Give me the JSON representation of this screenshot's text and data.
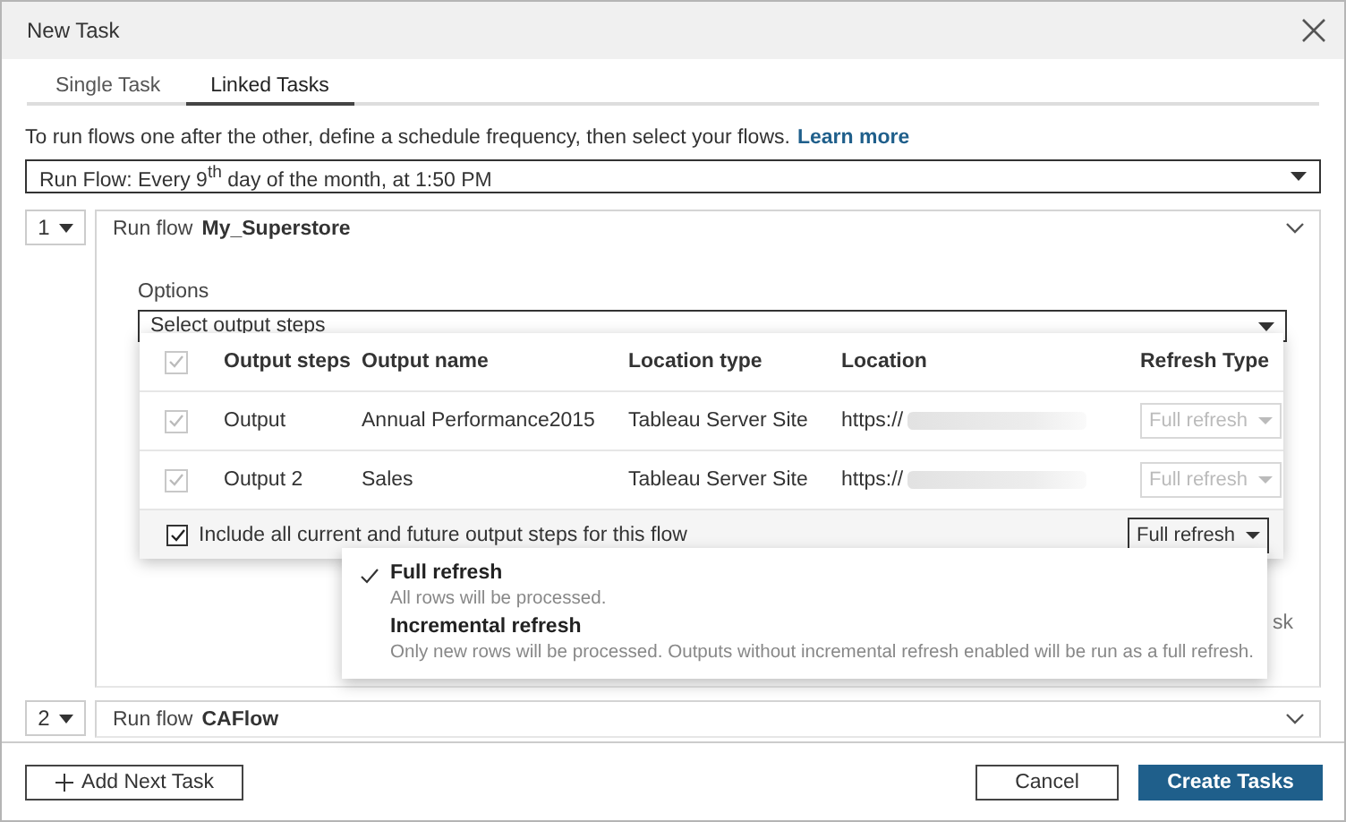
{
  "window": {
    "title": "New Task"
  },
  "tabs": [
    {
      "label": "Single Task",
      "selected": false
    },
    {
      "label": "Linked Tasks",
      "selected": true
    }
  ],
  "intro": {
    "text": "To run flows one after the other, define a schedule frequency, then select your flows.",
    "link": "Learn more"
  },
  "schedule": {
    "value": "Run Flow: Every 9$^{th}$ day of the month, at 1:50 PM"
  },
  "tasks": [
    {
      "number": "1",
      "prefix": "Run flow",
      "flow": "My_Superstore",
      "options": {
        "label": "Options",
        "select": "Select output steps",
        "header_checked": true,
        "header_disabled": true,
        "columns": [
          "Output steps",
          "Output name",
          "Location type",
          "Location",
          "Refresh Type"
        ],
        "rows": [
          {
            "step": "Output",
            "name": "Annual Performance2015",
            "location_type": "Tableau Server Site",
            "location": "https://",
            "refresh": "Full refresh",
            "checked": true,
            "disabled": true
          },
          {
            "step": "Output 2",
            "name": "Sales",
            "location_type": "Tableau Server Site",
            "location": "https://",
            "refresh": "Full refresh",
            "checked": true,
            "disabled": true
          }
        ],
        "include": {
          "label": "Include all current and future output steps for this flow",
          "checked": true,
          "refresh": "Full refresh"
        },
        "refresh_menu": [
          {
            "title": "Full refresh",
            "description": "All rows will be processed.",
            "selected": true
          },
          {
            "title": "Incremental refresh",
            "description": "Only new rows will be processed. Outputs without incremental refresh enabled will be run as a full refresh.",
            "selected": false
          }
        ],
        "partial_text": "sk"
      }
    },
    {
      "number": "2",
      "prefix": "Run flow",
      "flow": "CAFlow"
    }
  ],
  "footer": {
    "add": "Add Next Task",
    "cancel": "Cancel",
    "create": "Create Tasks"
  }
}
